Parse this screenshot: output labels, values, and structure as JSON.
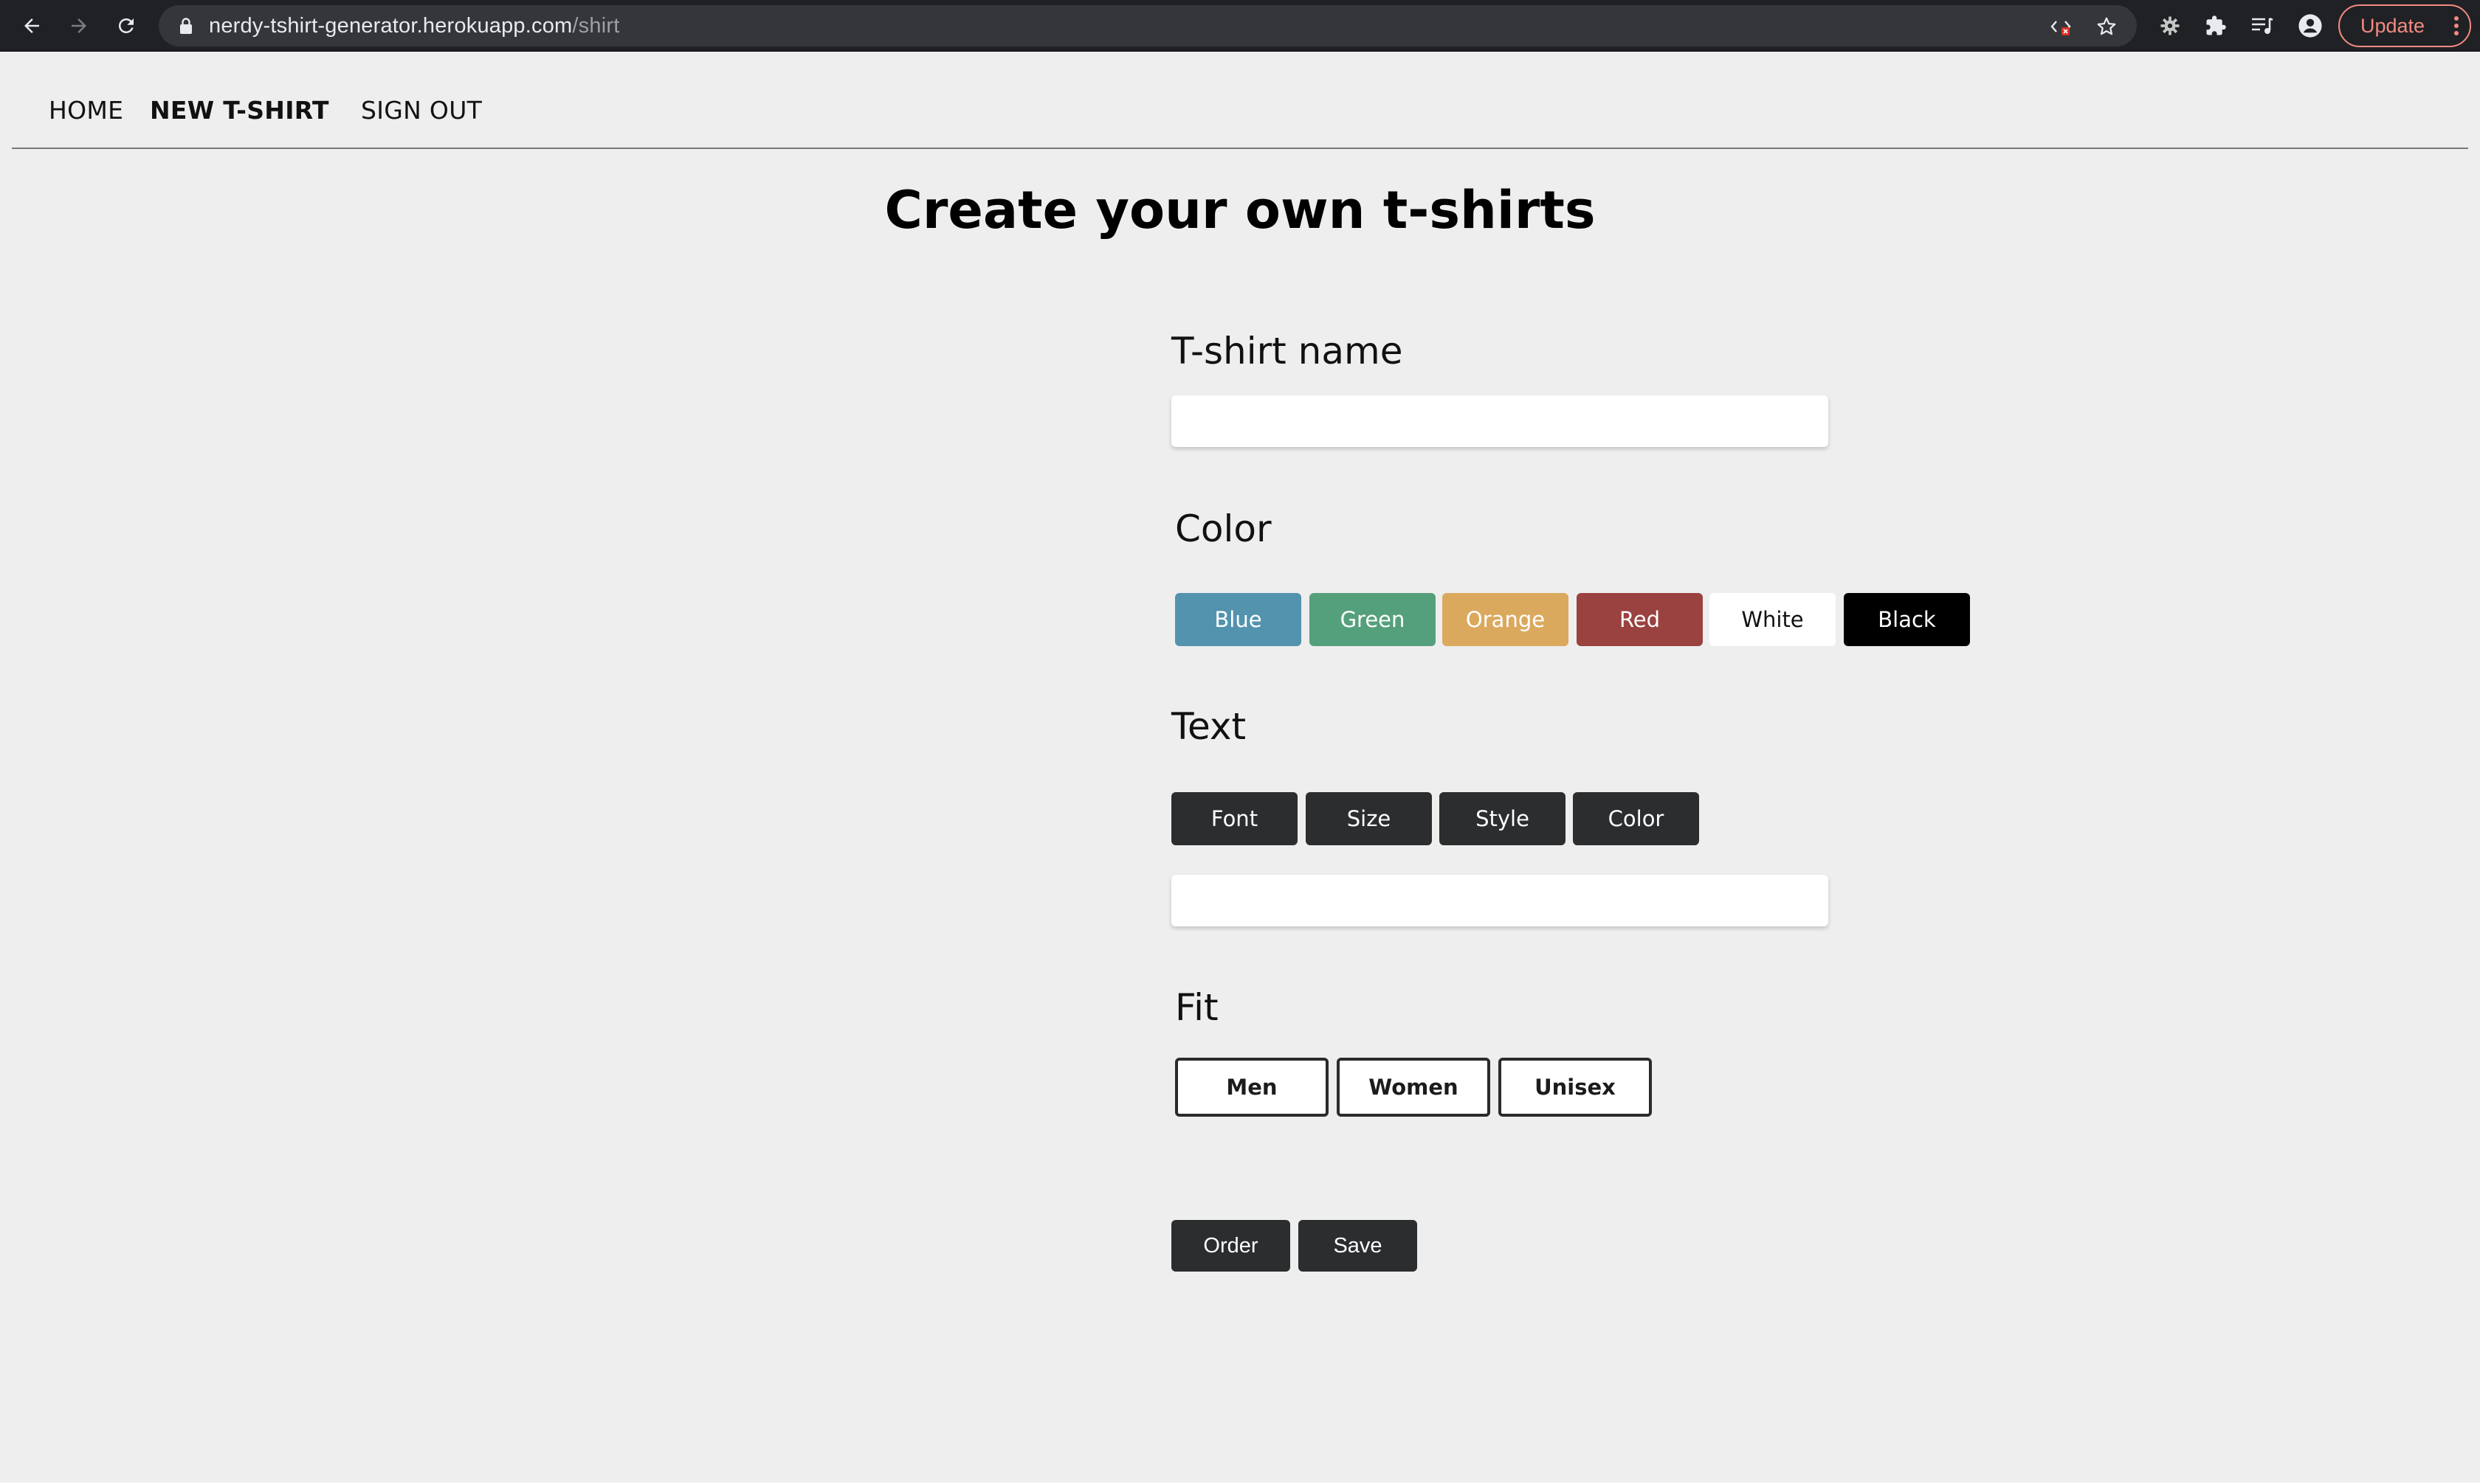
{
  "browser": {
    "url_host": "nerdy-tshirt-generator.herokuapp.com",
    "url_path": "/shirt",
    "update_label": "Update"
  },
  "nav": {
    "home": "HOME",
    "new_tshirt": "NEW T-SHIRT",
    "sign_out": "SIGN OUT",
    "active": "NEW T-SHIRT"
  },
  "page": {
    "title": "Create your own t-shirts"
  },
  "form": {
    "name_label": "T-shirt name",
    "name_value": "",
    "color_label": "Color",
    "colors": [
      {
        "label": "Blue",
        "bg": "#5393ae",
        "fg": "#ffffff"
      },
      {
        "label": "Green",
        "bg": "#55a07c",
        "fg": "#ffffff"
      },
      {
        "label": "Orange",
        "bg": "#dba95e",
        "fg": "#ffffff"
      },
      {
        "label": "Red",
        "bg": "#9a423f",
        "fg": "#ffffff"
      },
      {
        "label": "White",
        "bg": "#ffffff",
        "fg": "#111111"
      },
      {
        "label": "Black",
        "bg": "#000000",
        "fg": "#ffffff"
      }
    ],
    "text_label": "Text",
    "text_buttons": [
      "Font",
      "Size",
      "Style",
      "Color"
    ],
    "text_value": "",
    "fit_label": "Fit",
    "fit_options": [
      "Men",
      "Women",
      "Unisex"
    ],
    "order_label": "Order",
    "save_label": "Save"
  }
}
